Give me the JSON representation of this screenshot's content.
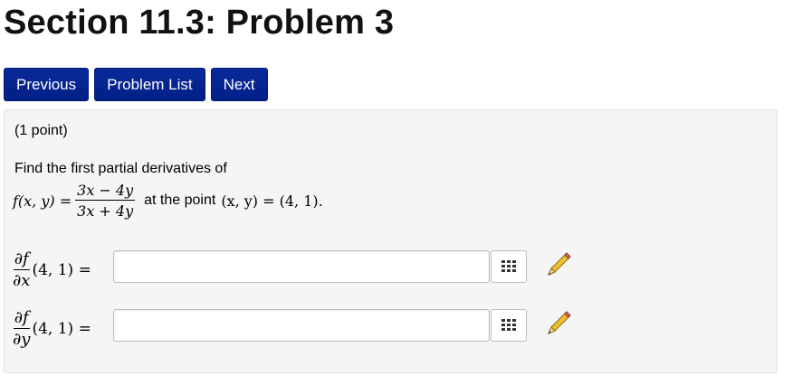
{
  "page": {
    "title": "Section 11.3: Problem 3"
  },
  "nav": {
    "previous_label": "Previous",
    "problem_list_label": "Problem List",
    "next_label": "Next"
  },
  "problem": {
    "points": "(1 point)",
    "prompt": "Find the first partial derivatives of",
    "function_lhs": "f(x, y) =",
    "numerator": "3x − 4y",
    "denominator": "3x + 4y",
    "at_text": "at the point",
    "point_text": "(x, y) = (4, 1)."
  },
  "answers": [
    {
      "num": "∂f",
      "den": "∂x",
      "tail": "(4, 1) =",
      "value": ""
    },
    {
      "num": "∂f",
      "den": "∂y",
      "tail": "(4, 1) =",
      "value": ""
    }
  ],
  "icons": {
    "palette": "equation-editor-grid-icon",
    "pencil": "pencil-icon"
  },
  "colors": {
    "button_bg": "#0a2a9a",
    "well_bg": "#f5f5f5",
    "pencil_body": "#f0c030"
  }
}
